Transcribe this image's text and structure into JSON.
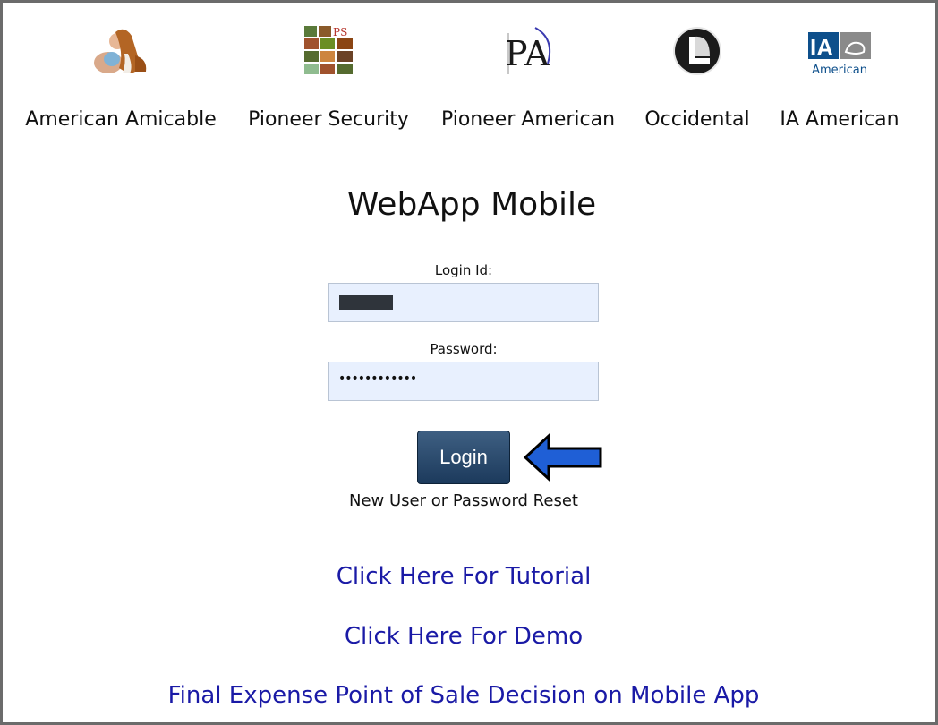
{
  "carriers": [
    {
      "name": "American Amicable",
      "icon": "dog-logo-icon"
    },
    {
      "name": "Pioneer Security",
      "icon": "ps-logo-icon",
      "logo_text": "PS"
    },
    {
      "name": "Pioneer American",
      "icon": "pa-logo-icon",
      "logo_text": "PA"
    },
    {
      "name": "Occidental",
      "icon": "occidental-logo-icon"
    },
    {
      "name": "IA American",
      "icon": "ia-logo-icon",
      "logo_text": "IA",
      "logo_subtext": "American"
    }
  ],
  "title": "WebApp Mobile",
  "login": {
    "id_label": "Login Id:",
    "password_label": "Password:",
    "password_value": "••••••••••••",
    "button_label": "Login"
  },
  "links": {
    "reset": "New User or Password Reset",
    "tutorial": "Click Here For Tutorial",
    "demo": "Click Here For Demo",
    "final_expense": "Final Expense Point of Sale Decision on Mobile App"
  },
  "colors": {
    "link_blue": "#1a1aa6",
    "button": "#24456a",
    "arrow": "#1f5fd6",
    "field_bg": "#e8f0fe"
  }
}
